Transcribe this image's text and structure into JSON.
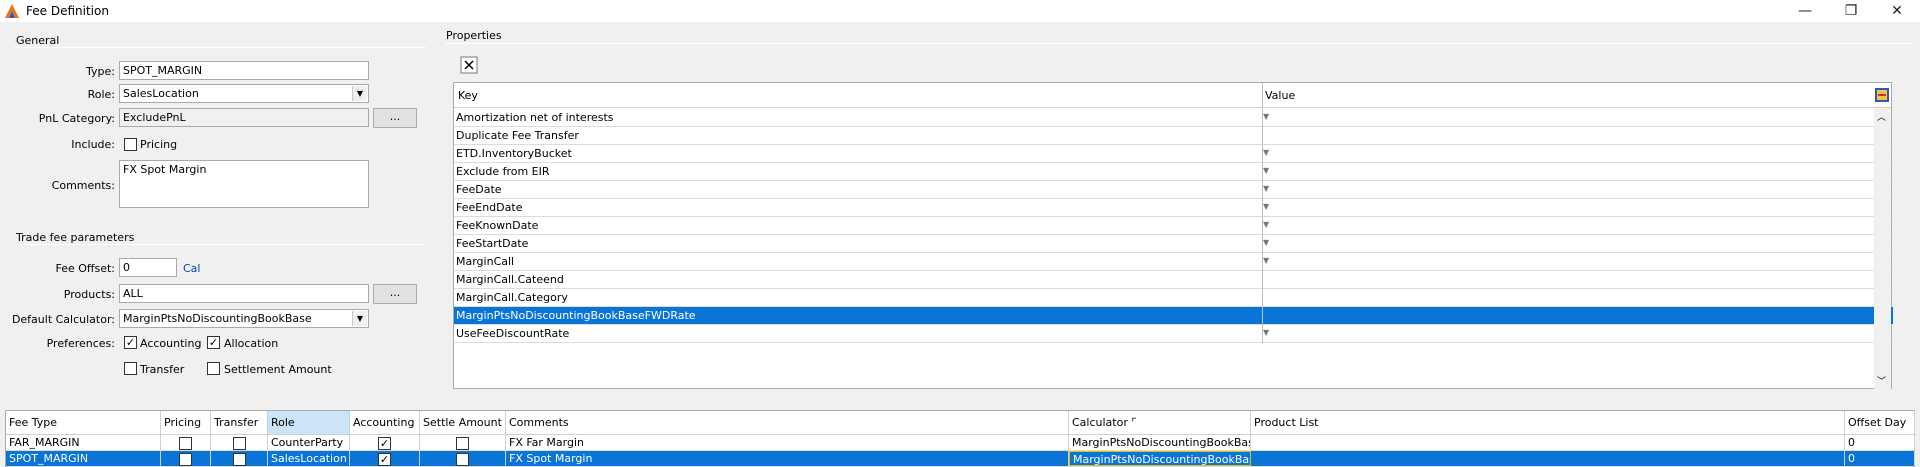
{
  "window": {
    "title": "Fee Definition",
    "min": "—",
    "max": "❐",
    "close": "✕"
  },
  "general": {
    "title": "General",
    "type_label": "Type:",
    "type_value": "SPOT_MARGIN",
    "role_label": "Role:",
    "role_value": "SalesLocation",
    "pnl_label": "PnL Category:",
    "pnl_value": "ExcludePnL",
    "pnl_btn": "...",
    "include_label": "Include:",
    "include_pricing": "Pricing",
    "comments_label": "Comments:",
    "comments_value": "FX Spot Margin"
  },
  "trade": {
    "title": "Trade fee parameters",
    "offset_label": "Fee Offset:",
    "offset_value": "0",
    "offset_link": "Cal",
    "products_label": "Products:",
    "products_value": "ALL",
    "products_btn": "...",
    "calc_label": "Default Calculator:",
    "calc_value": "MarginPtsNoDiscountingBookBase",
    "pref_label": "Preferences:",
    "pref_accounting": "Accounting",
    "pref_allocation": "Allocation",
    "pref_transfer": "Transfer",
    "pref_settlement": "Settlement Amount"
  },
  "properties": {
    "title": "Properties",
    "key_header": "Key",
    "value_header": "Value",
    "rows": [
      {
        "key": "Amortization net of interests",
        "arrow": true
      },
      {
        "key": "Duplicate Fee Transfer",
        "arrow": false
      },
      {
        "key": "ETD.InventoryBucket",
        "arrow": true
      },
      {
        "key": "Exclude from EIR",
        "arrow": true
      },
      {
        "key": "FeeDate",
        "arrow": true
      },
      {
        "key": "FeeEndDate",
        "arrow": true
      },
      {
        "key": "FeeKnownDate",
        "arrow": true
      },
      {
        "key": "FeeStartDate",
        "arrow": true
      },
      {
        "key": "MarginCall",
        "arrow": true
      },
      {
        "key": "MarginCall.Cateend",
        "arrow": false
      },
      {
        "key": "MarginCall.Category",
        "arrow": false
      },
      {
        "key": "MarginPtsNoDiscountingBookBaseFWDRate",
        "arrow": false,
        "selected": true
      },
      {
        "key": "UseFeeDiscountRate",
        "arrow": true
      }
    ]
  },
  "grid": {
    "headers": [
      "Fee Type",
      "Pricing",
      "Transfer",
      "Role",
      "Accounting",
      "Settle Amount",
      "Comments",
      "Calculator",
      "Product List",
      "Offset Day"
    ],
    "rows": [
      {
        "fee_type": "FAR_MARGIN",
        "pricing": false,
        "transfer": false,
        "role": "CounterParty",
        "accounting": true,
        "settle": false,
        "comments": "FX Far Margin",
        "calculator": "MarginPtsNoDiscountingBookBase",
        "product_list": "",
        "offset": "0"
      },
      {
        "fee_type": "SPOT_MARGIN",
        "pricing": false,
        "transfer": false,
        "role": "SalesLocation",
        "accounting": true,
        "settle": false,
        "comments": "FX Spot Margin",
        "calculator": "MarginPtsNoDiscountingBookBase",
        "product_list": "",
        "offset": "0",
        "selected": true
      }
    ]
  }
}
